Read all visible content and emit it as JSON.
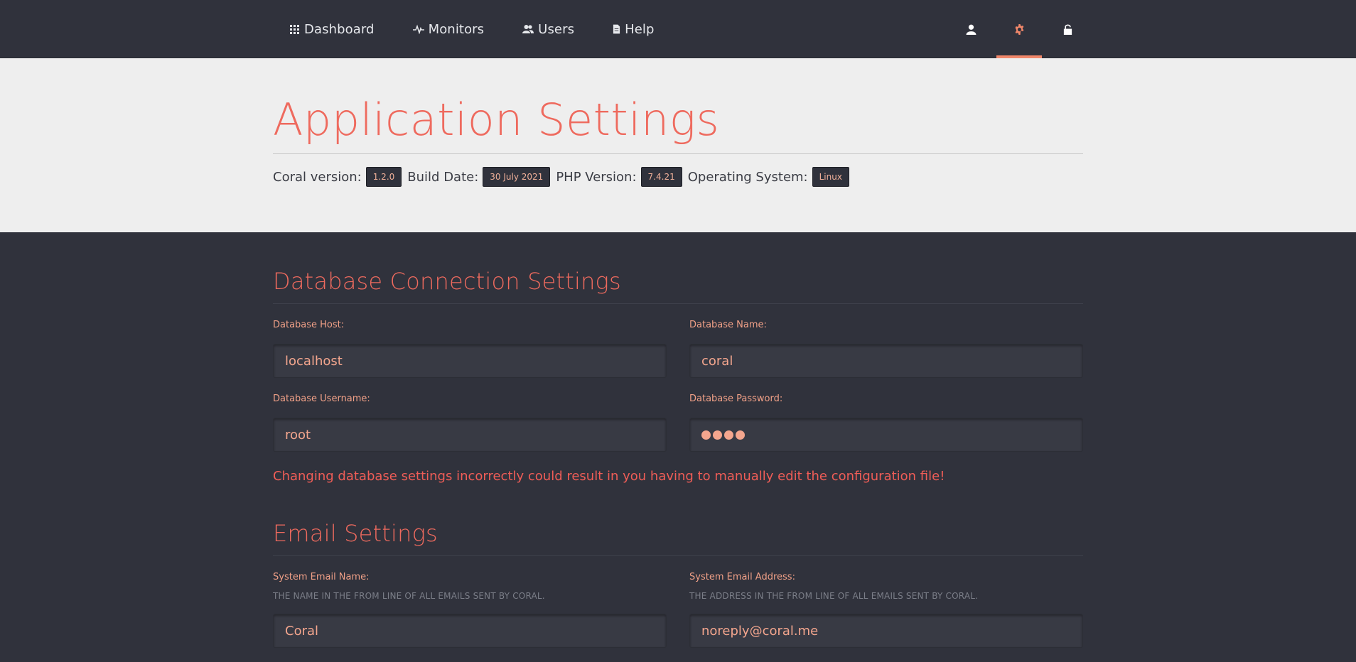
{
  "nav": {
    "items": [
      {
        "label": "Dashboard",
        "icon": "grid-icon"
      },
      {
        "label": "Monitors",
        "icon": "pulse-icon"
      },
      {
        "label": "Users",
        "icon": "users-icon"
      },
      {
        "label": "Help",
        "icon": "document-icon"
      }
    ],
    "right_icons": [
      "user-icon",
      "gear-icon",
      "unlock-icon"
    ],
    "accent": "#f0876a"
  },
  "hero": {
    "title": "Application Settings",
    "coral_version_label": "Coral version:",
    "coral_version": "1.2.0",
    "build_date_label": "Build Date:",
    "build_date": "30 July 2021",
    "php_version_label": "PHP Version:",
    "php_version": "7.4.21",
    "os_label": "Operating System:",
    "os": "Linux"
  },
  "database": {
    "title": "Database Connection Settings",
    "host_label": "Database Host:",
    "host_value": "localhost",
    "name_label": "Database Name:",
    "name_value": "coral",
    "username_label": "Database Username:",
    "username_value": "root",
    "password_label": "Database Password:",
    "password_length": 4,
    "warning": "Changing database settings incorrectly could result in you having to manually edit the configuration file!"
  },
  "email": {
    "title": "Email Settings",
    "name_label": "System Email Name:",
    "name_help": "THE NAME IN THE FROM LINE OF ALL EMAILS SENT BY CORAL.",
    "name_value": "Coral",
    "address_label": "System Email Address:",
    "address_help": "THE ADDRESS IN THE FROM LINE OF ALL EMAILS SENT BY CORAL.",
    "address_value": "noreply@coral.me"
  }
}
